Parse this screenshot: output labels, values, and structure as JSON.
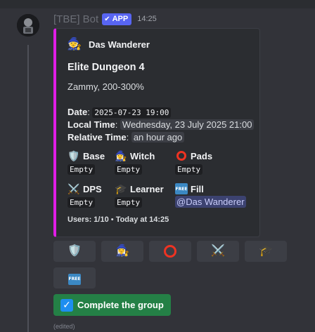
{
  "message": {
    "bot_name": "[TBE] Bot",
    "app_badge": "APP",
    "timestamp": "14:25",
    "edited": "(edited)"
  },
  "embed": {
    "accent_color": "#e01ee6",
    "author": "Das Wanderer",
    "title": "Elite Dungeon 4",
    "description": "Zammy, 200-300%",
    "date_label": "Date",
    "date_value": "2025-07-23 19:00",
    "local_time_label": "Local Time",
    "local_time_value": "Wednesday, 23 July 2025 21:00",
    "relative_time_label": "Relative Time",
    "relative_time_value": "an hour ago",
    "fields": [
      {
        "icon": "shield-icon",
        "name": "Base",
        "value": "Empty"
      },
      {
        "icon": "mage-icon",
        "name": "Witch",
        "value": "Empty"
      },
      {
        "icon": "red-circle-icon",
        "name": "Pads",
        "value": "Empty"
      },
      {
        "icon": "crossed-swords-icon",
        "name": "DPS",
        "value": "Empty"
      },
      {
        "icon": "graduation-cap-icon",
        "name": "Learner",
        "value": "Empty"
      },
      {
        "icon": "free-icon",
        "name": "Fill",
        "value": "@Das Wanderer"
      }
    ],
    "footer_users": "Users: 1/10",
    "footer_sep": " • ",
    "footer_time": "Today at 14:25"
  },
  "buttons": {
    "role_icons": [
      "shield-icon",
      "mage-icon",
      "red-circle-icon",
      "crossed-swords-icon",
      "graduation-cap-icon",
      "free-icon"
    ],
    "free_text": "FREE",
    "complete_label": "Complete the group",
    "complete_color": "#248046"
  }
}
